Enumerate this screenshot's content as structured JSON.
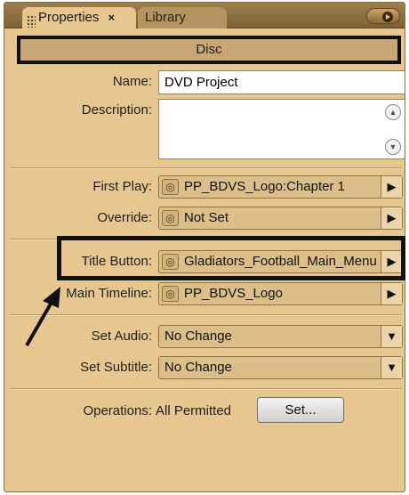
{
  "tabs": [
    {
      "label": "Properties",
      "close": "×"
    },
    {
      "label": "Library"
    }
  ],
  "panel_menu_icon": "panel-menu-icon",
  "section_header": "Disc",
  "name": {
    "label": "Name:",
    "value": "DVD Project"
  },
  "description": {
    "label": "Description:",
    "value": ""
  },
  "first_play": {
    "label": "First Play:",
    "value": "PP_BDVS_Logo:Chapter 1"
  },
  "override": {
    "label": "Override:",
    "value": "Not Set"
  },
  "title_button": {
    "label": "Title Button:",
    "value": "Gladiators_Football_Main_Menu"
  },
  "main_timeline": {
    "label": "Main Timeline:",
    "value": "PP_BDVS_Logo"
  },
  "set_audio": {
    "label": "Set Audio:",
    "value": "No Change"
  },
  "set_subtitle": {
    "label": "Set Subtitle:",
    "value": "No Change"
  },
  "operations": {
    "label": "Operations:",
    "value": "All Permitted",
    "button": "Set..."
  },
  "colors": {
    "panel": "#e7c790",
    "tabbar": "#8c6f3f",
    "highlight": "#111111"
  }
}
